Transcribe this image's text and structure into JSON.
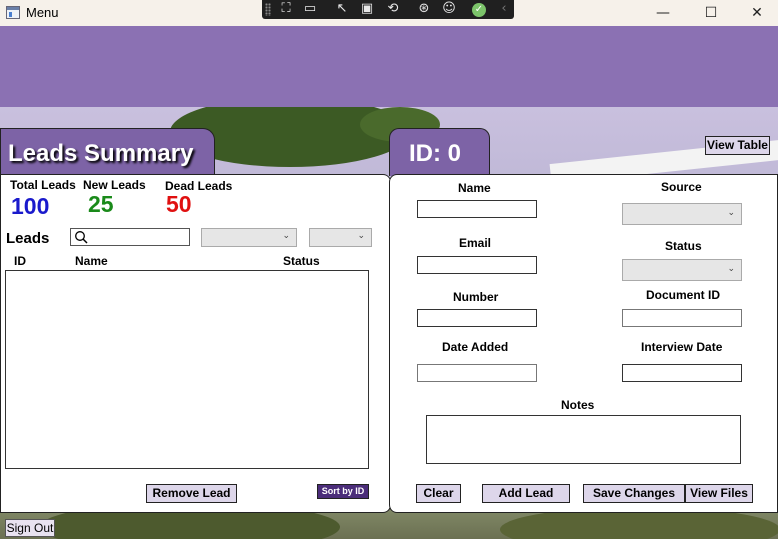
{
  "window": {
    "title": "Menu",
    "controls": {
      "minimize": "—",
      "maximize": "☐",
      "close": "✕"
    }
  },
  "debug_toolbar": {
    "icons": [
      "select-element-icon",
      "video-icon",
      "pointer-icon",
      "layout-icon",
      "refresh-pointer-icon",
      "accessibility-icon",
      "accessibility-person-icon",
      "check-icon",
      "chevron-left-icon"
    ]
  },
  "colors": {
    "header": "#8b71b3",
    "tab": "#7d63a6",
    "total": "#1a1acc",
    "new": "#1a8a1a",
    "dead": "#e01010"
  },
  "view_table_label": "View Table",
  "summary": {
    "title": "Leads Summary",
    "total_label": "Total Leads",
    "total_value": "100",
    "new_label": "New Leads",
    "new_value": "25",
    "dead_label": "Dead Leads",
    "dead_value": "50",
    "leads_label": "Leads",
    "search_placeholder": "",
    "filter1_value": "",
    "filter2_value": "",
    "columns": {
      "id": "ID",
      "name": "Name",
      "status": "Status"
    },
    "rows": [],
    "remove_label": "Remove Lead",
    "sort_label": "Sort by ID"
  },
  "detail": {
    "title": "ID: 0",
    "name_label": "Name",
    "name_value": "",
    "source_label": "Source",
    "source_value": "",
    "email_label": "Email",
    "email_value": "",
    "status_label": "Status",
    "status_value": "",
    "number_label": "Number",
    "number_value": "",
    "docid_label": "Document ID",
    "docid_value": "",
    "date_added_label": "Date Added",
    "date_added_value": "",
    "interview_label": "Interview Date",
    "interview_value": "",
    "notes_label": "Notes",
    "notes_value": "",
    "clear_label": "Clear",
    "add_label": "Add Lead",
    "save_label": "Save Changes",
    "files_label": "View Files"
  },
  "sign_out_label": "Sign Out"
}
